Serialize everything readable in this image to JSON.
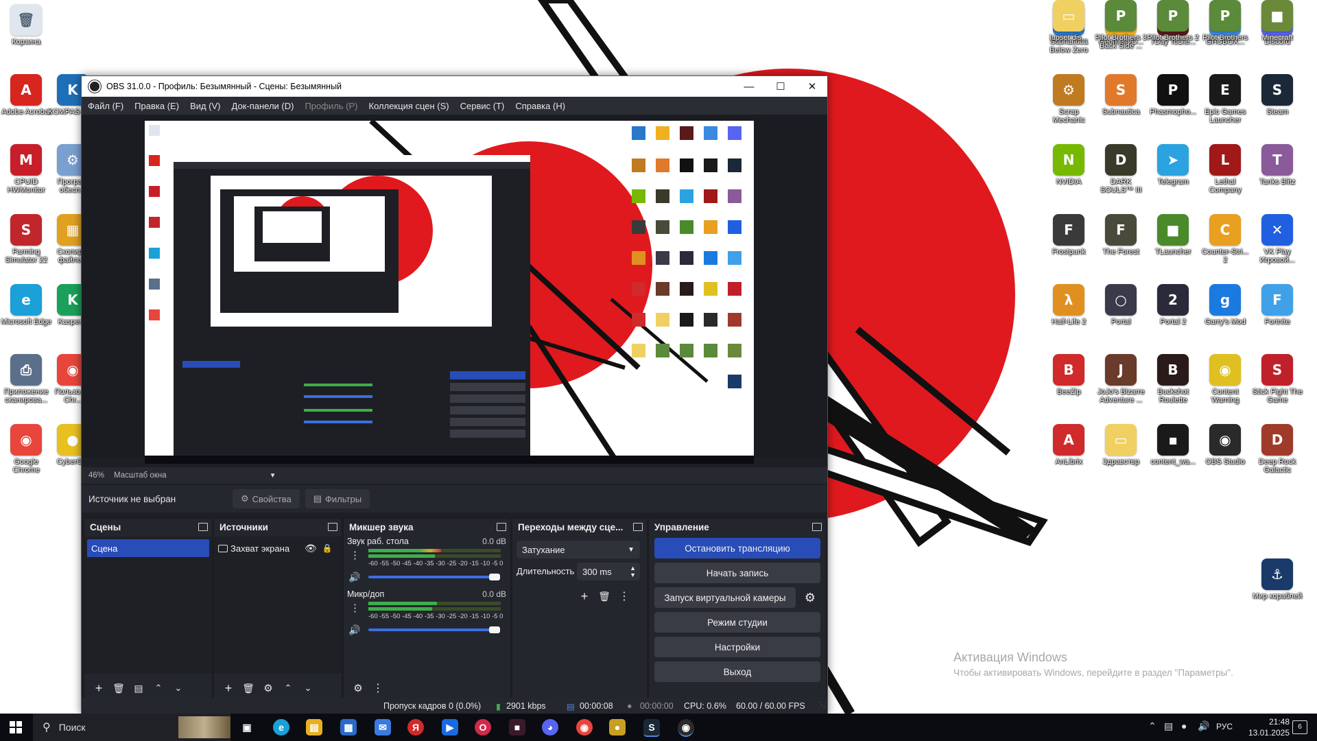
{
  "desktop": {
    "icons_left": [
      {
        "label": "Корзина",
        "glyph": "🗑",
        "color": "#dfe6ee"
      },
      {
        "label": "Adobe Acrobat",
        "glyph": "A",
        "color": "#d7261e"
      },
      {
        "label": "CPUID HWMonitor",
        "glyph": "M",
        "color": "#c81e2a"
      },
      {
        "label": "Farming Simulator 22",
        "glyph": "S",
        "color": "#c0262c"
      },
      {
        "label": "Microsoft Edge",
        "glyph": "e",
        "color": "#1ba0d8"
      },
      {
        "label": "Приложение сканирова...",
        "glyph": "⎙",
        "color": "#5a6f8a"
      },
      {
        "label": "Google Chrome",
        "glyph": "◉",
        "color": "#e8453c"
      }
    ],
    "icons_left2": [
      {
        "label": "KOMPAS-3D v",
        "glyph": "K",
        "color": "#1d6fb8"
      },
      {
        "label": "Програ... обесп...",
        "glyph": "⚙",
        "color": "#7aa0d0"
      },
      {
        "label": "Скопир... файле...",
        "glyph": "▦",
        "color": "#e0a020"
      },
      {
        "label": "Kasper...",
        "glyph": "K",
        "color": "#1aa05a"
      },
      {
        "label": "Пользо... - Chr...",
        "glyph": "◉",
        "color": "#e8453c"
      },
      {
        "label": "CyberG...",
        "glyph": "●",
        "color": "#e8c020"
      }
    ],
    "icons_right": [
      {
        "label": "Subnautica Below Zero",
        "glyph": "S",
        "color": "#2a78c8"
      },
      {
        "label": "GeometryD...",
        "glyph": "◆",
        "color": "#f0b020"
      },
      {
        "label": "7Day ToDie...",
        "glyph": "7",
        "color": "#5a1a1a"
      },
      {
        "label": "GHUBOX...",
        "glyph": "G",
        "color": "#3a8ae0"
      },
      {
        "label": "Discord",
        "glyph": "◕",
        "color": "#5865f2"
      },
      {
        "label": "Scrap Mechanic",
        "glyph": "⚙",
        "color": "#c07a20"
      },
      {
        "label": "Subnautica",
        "glyph": "S",
        "color": "#e07a2a"
      },
      {
        "label": "Phasmopho...",
        "glyph": "P",
        "color": "#111111"
      },
      {
        "label": "Epic Games Launcher",
        "glyph": "E",
        "color": "#1a1a1a"
      },
      {
        "label": "Steam",
        "glyph": "S",
        "color": "#1b2838"
      },
      {
        "label": "NVIDIA",
        "glyph": "N",
        "color": "#76b900"
      },
      {
        "label": "DARK SOULS™ III",
        "glyph": "D",
        "color": "#3a3a2a"
      },
      {
        "label": "Telegram",
        "glyph": "➤",
        "color": "#2aa3e0"
      },
      {
        "label": "Lethal Company",
        "glyph": "L",
        "color": "#a01818"
      },
      {
        "label": "Tanks Blitz",
        "glyph": "T",
        "color": "#8a5a9a"
      },
      {
        "label": "Frostpunk",
        "glyph": "F",
        "color": "#3a3a3a"
      },
      {
        "label": "The Forest",
        "glyph": "F",
        "color": "#4a4a3a"
      },
      {
        "label": "TLauncher",
        "glyph": "■",
        "color": "#4a8a2a"
      },
      {
        "label": "Counter-Stri... 2",
        "glyph": "C",
        "color": "#e8a020"
      },
      {
        "label": "VK Play Игровой...",
        "glyph": "✕",
        "color": "#2060e0"
      },
      {
        "label": "Half-Life 2",
        "glyph": "λ",
        "color": "#e09020"
      },
      {
        "label": "Portal",
        "glyph": "○",
        "color": "#3a3a4a"
      },
      {
        "label": "Portal 2",
        "glyph": "2",
        "color": "#2a2a3a"
      },
      {
        "label": "Garry's Mod",
        "glyph": "g",
        "color": "#1a7ae0"
      },
      {
        "label": "Fortnite",
        "glyph": "F",
        "color": "#40a0e8"
      },
      {
        "label": "BeeZip",
        "glyph": "B",
        "color": "#d02a2a"
      },
      {
        "label": "JoJo's Bizarre Adventure ...",
        "glyph": "J",
        "color": "#6a3a2a"
      },
      {
        "label": "Buckshot Roulette",
        "glyph": "B",
        "color": "#2a1a1a"
      },
      {
        "label": "Content Warning",
        "glyph": "◉",
        "color": "#e0c020"
      },
      {
        "label": "Stick Fight The Game",
        "glyph": "S",
        "color": "#c0202a"
      },
      {
        "label": "AnLibrix",
        "glyph": "A",
        "color": "#d02a2a"
      },
      {
        "label": "Здравствр",
        "glyph": "▭",
        "color": "#f0d060"
      },
      {
        "label": "content_wa...",
        "glyph": "▪",
        "color": "#1a1a1a"
      },
      {
        "label": "OBS Studio",
        "glyph": "◉",
        "color": "#2a2a2a"
      },
      {
        "label": "Deep Rock Galactic",
        "glyph": "D",
        "color": "#a03a2a"
      },
      {
        "label": "lapset dis...",
        "glyph": "▭",
        "color": "#f0d060"
      },
      {
        "label": "Pilot Brothers 3 Back Side ...",
        "glyph": "P",
        "color": "#5a8a3a"
      },
      {
        "label": "Pilot Brothers 2",
        "glyph": "P",
        "color": "#5a8a3a"
      },
      {
        "label": "Pilot Brothers",
        "glyph": "P",
        "color": "#5a8a3a"
      },
      {
        "label": "Minecraft",
        "glyph": "■",
        "color": "#6a8a3a"
      },
      {
        "label": "Мир кораблей",
        "glyph": "⚓",
        "color": "#1a3a6a"
      }
    ],
    "watermark_title": "Активация Windows",
    "watermark_text": "Чтобы активировать Windows, перейдите в раздел \"Параметры\"."
  },
  "obs": {
    "title": "OBS 31.0.0 - Профиль: Безымянный - Сцены: Безымянный",
    "menu": [
      {
        "label": "Файл (F)",
        "disabled": false
      },
      {
        "label": "Правка (E)",
        "disabled": false
      },
      {
        "label": "Вид (V)",
        "disabled": false
      },
      {
        "label": "Док-панели (D)",
        "disabled": false
      },
      {
        "label": "Профиль (P)",
        "disabled": true
      },
      {
        "label": "Коллекция сцен (S)",
        "disabled": false
      },
      {
        "label": "Сервис (T)",
        "disabled": false
      },
      {
        "label": "Справка (H)",
        "disabled": false
      }
    ],
    "zoom": "46%",
    "scale_mode": "Масштаб окна",
    "no_source": "Источник не выбран",
    "properties_btn": "Свойства",
    "filters_btn": "Фильтры",
    "scenes": {
      "title": "Сцены",
      "items": [
        "Сцена"
      ]
    },
    "sources": {
      "title": "Источники",
      "items": [
        "Захват экрана"
      ]
    },
    "mixer": {
      "title": "Микшер звука",
      "channels": [
        {
          "name": "Звук раб. стола",
          "db": "0.0 dB",
          "level": 0.55
        },
        {
          "name": "Микр/доп",
          "db": "0.0 dB",
          "level": 0.5
        }
      ],
      "scale": "-60 -55 -50 -45 -40 -35 -30 -25 -20 -15 -10 -5 0"
    },
    "transitions": {
      "title": "Переходы между сце...",
      "selected": "Затухание",
      "duration_label": "Длительность",
      "duration_value": "300 ms"
    },
    "controls": {
      "title": "Управление",
      "stop_stream": "Остановить трансляцию",
      "start_record": "Начать запись",
      "virtual_cam": "Запуск виртуальной камеры",
      "studio_mode": "Режим студии",
      "settings": "Настройки",
      "exit": "Выход"
    },
    "status": {
      "dropped": "Пропуск кадров 0 (0.0%)",
      "bitrate": "2901 kbps",
      "stream_time": "00:00:08",
      "rec_time": "00:00:00",
      "cpu": "CPU: 0.6%",
      "fps": "60.00 / 60.00 FPS"
    }
  },
  "taskbar": {
    "search": "Поиск",
    "lang": "РУС",
    "time": "21:48",
    "date": "13.01.2025",
    "notif_count": "6"
  },
  "colors": {
    "accent": "#284cb8",
    "sun_red": "#e0191e"
  }
}
